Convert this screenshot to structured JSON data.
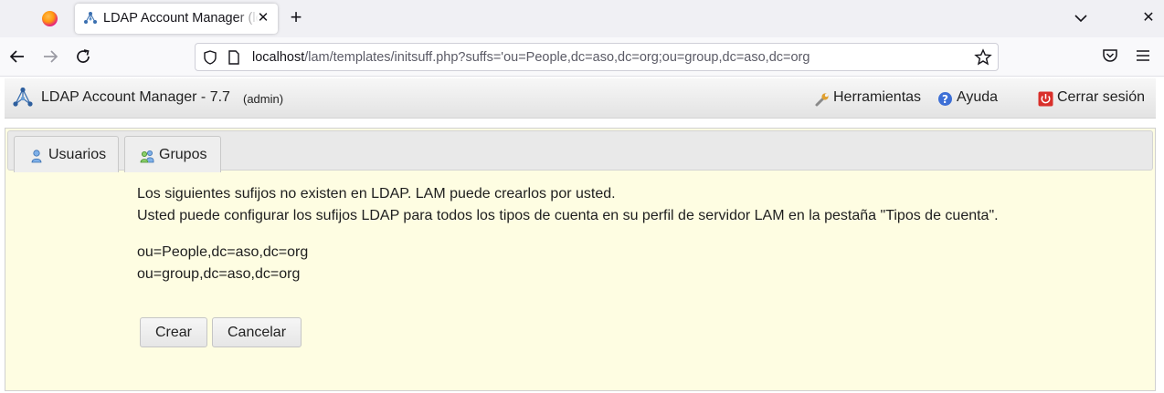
{
  "browser": {
    "tab_title": "LDAP Account Manager (localhost)",
    "url_host": "localhost",
    "url_path": "/lam/templates/initsuff.php?suffs='ou=People,dc=aso,dc=org;ou=group,dc=aso,dc=org"
  },
  "header": {
    "title": "LDAP Account Manager - 7.7",
    "user": "(admin)",
    "tools_label": "Herramientas",
    "help_label": "Ayuda",
    "logout_label": "Cerrar sesión"
  },
  "tabs": [
    {
      "label": "Usuarios",
      "icon": "user-icon"
    },
    {
      "label": "Grupos",
      "icon": "group-icon"
    }
  ],
  "message": {
    "line1": "Los siguientes sufijos no existen en LDAP. LAM puede crearlos por usted.",
    "line2": "Usted puede configurar los sufijos LDAP para todos los tipos de cuenta en su perfil de servidor LAM en la pestaña \"Tipos de cuenta\"."
  },
  "suffixes": [
    "ou=People,dc=aso,dc=org",
    "ou=group,dc=aso,dc=org"
  ],
  "buttons": {
    "create": "Crear",
    "cancel": "Cancelar"
  },
  "colors": {
    "content_bg": "#fefde2",
    "logout_icon": "#d9302b",
    "help_icon": "#3d6fd6"
  }
}
